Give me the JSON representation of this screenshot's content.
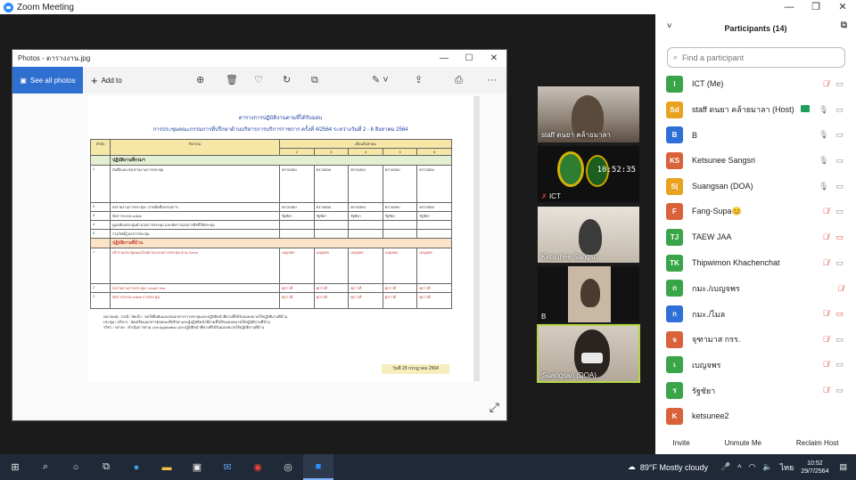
{
  "window": {
    "title": "Zoom Meeting"
  },
  "photos": {
    "title": "Photos - ตารางงาน.jpg",
    "see_all": "See all photos",
    "add_to": "Add to"
  },
  "document": {
    "title1": "ตารางการปฏิบัติงานตามที่ได้รับมอบ",
    "title2": "การประชุมคณะกรรมการที่ปรึกษาด้านบริหารการบริการราชการ ครั้งที่ 4/2564 ระหว่างวันที่ 2 - 6 สิงหาคม 2564",
    "col_no": "ลำดับ",
    "col_task": "กิจกรรม",
    "col_days": "เดือนสิงหาคม",
    "days": [
      "2",
      "3",
      "4",
      "5",
      "6"
    ],
    "section1": "ปฏิบัติงานที่กรมฯ",
    "section2": "ปฏิบัติงานที่บ้าน",
    "rows1": [
      {
        "no": "1",
        "task": "บันทึกและสรุปรายงานการประชุม",
        "cell": "ตรวจสอบ"
      },
      {
        "no": "2",
        "task": "ส่งรายงานการประชุม / ลายมือชื่อกรรมการ",
        "cell": "ตรวจสอบ"
      },
      {
        "no": "3",
        "task": "จัดการระบบ online",
        "cell": "รัฐชัยา"
      },
      {
        "no": "4",
        "task": "ดูแลห้องประชุมอำนวยการประชุม และจัดการเอกสารสิ่งที่ใช้ประชุม",
        "cell": ""
      },
      {
        "no": "5",
        "task": "รวมไฟล์ผู้ ผลการประชุม",
        "cell": ""
      }
    ],
    "rows2": [
      {
        "no": "1",
        "task": "เข้าร่วมประชุมออนไลน์ผ่านระบบการประชุม ผ่าน Zoom",
        "cell": "เบญจพร"
      },
      {
        "no": "2",
        "task": "ส่งรายงานการประชุม / email / line",
        "cell": "ศุภาวดี"
      },
      {
        "no": "3",
        "task": "จัดการระบบ online การประชุม",
        "cell": "ศุภาวดี"
      }
    ],
    "notes": [
      "หมายเหตุ : กรณี / จัดเก็บ : ขอให้ยืนยันและส่งเอกสารการประชุมและปฏิบัติหน้าที่ตามที่ได้รับมอบหมายให้ปฏิบัติงานที่บ้าน",
      "ประชุม / บริหาร : จัดเตรียมเอกสารต่อคณะที่ปรึกษาและผู้ปฏิบัติหน้าที่ตามที่ได้รับมอบหมายให้ปฏิบัติงานที่บ้าน",
      "รวิชา / รสายะ : ดำเนินการตาม Line Application และปฏิบัติหน้าที่ตามที่ได้รับมอบหมายให้ปฏิบัติงานที่บ้าน"
    ],
    "date": "วันที่ 29 กรกฎาคม 2564"
  },
  "videos": [
    {
      "name": "staff ดนยา คล้ายมาลา"
    },
    {
      "name": "ICT",
      "clock": "10:52:35"
    },
    {
      "name": "Ketsunee Sangsri"
    },
    {
      "name": "B"
    },
    {
      "name": "Suangsan (DOA)"
    }
  ],
  "participants": {
    "header": "Participants (14)",
    "search_placeholder": "Find a participant",
    "list": [
      {
        "initials": "I",
        "color": "#3aa548",
        "name": "ICT (Me)",
        "mic": "muted",
        "cam": "on"
      },
      {
        "initials": "Sd",
        "color": "#e8a21d",
        "name": "staff ดนยา คล้ายมาลา (Host)",
        "mic": "on",
        "cam": "on",
        "host": true
      },
      {
        "initials": "B",
        "color": "#2e6fd8",
        "name": "B",
        "mic": "on",
        "cam": "on"
      },
      {
        "initials": "KS",
        "color": "#d9623a",
        "name": "Ketsunee Sangsri",
        "mic": "on",
        "cam": "on"
      },
      {
        "initials": "S(",
        "color": "#e8a21d",
        "name": "Suangsan (DOA)",
        "mic": "on",
        "cam": "on"
      },
      {
        "initials": "F",
        "color": "#d9623a",
        "name": "Fang-Supa😊",
        "mic": "muted",
        "cam": "on"
      },
      {
        "initials": "TJ",
        "color": "#3aa548",
        "name": "TAEW JAA",
        "mic": "muted",
        "cam": "off"
      },
      {
        "initials": "TK",
        "color": "#3aa548",
        "name": "Thipwimon Khachenchat",
        "mic": "muted",
        "cam": "on"
      },
      {
        "initials": "ก",
        "color": "#3aa548",
        "name": "กมะ./เบญจพร",
        "mic": "muted",
        "cam": ""
      },
      {
        "initials": "ก",
        "color": "#2e6fd8",
        "name": "กมะ./ไมล",
        "mic": "muted",
        "cam": "off"
      },
      {
        "initials": "จ",
        "color": "#d9623a",
        "name": "จุฑามาส กรร.",
        "mic": "muted",
        "cam": "on"
      },
      {
        "initials": "เ",
        "color": "#3aa548",
        "name": "เบญจพร",
        "mic": "muted",
        "cam": "on"
      },
      {
        "initials": "ร",
        "color": "#3aa548",
        "name": "รัฐชัยา",
        "mic": "muted",
        "cam": "on"
      },
      {
        "initials": "K",
        "color": "#d9623a",
        "name": "ketsunee2",
        "mic": "",
        "cam": ""
      }
    ],
    "invite": "Invite",
    "unmute": "Unmute Me",
    "reclaim": "Reclaim Host"
  },
  "taskbar": {
    "weather": "89°F  Mostly cloudy",
    "lang": "ไทย",
    "time": "10:52",
    "date": "29/7/2564"
  }
}
